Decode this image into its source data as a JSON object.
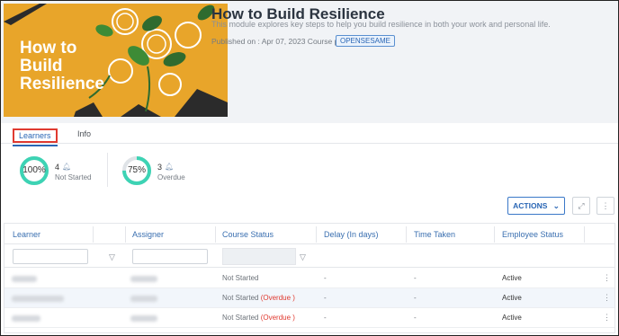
{
  "course": {
    "thumbnail_text": "How to Build Resilience",
    "title": "How to Build Resilience",
    "description": "This module explores key steps to help you build resilience in both your work and personal life.",
    "published": "Published on : Apr 07, 2023 Course provider :",
    "provider": "OPENSESAME"
  },
  "tabs": [
    {
      "label": "Learners",
      "active": true
    },
    {
      "label": "Info",
      "active": false
    }
  ],
  "stats": [
    {
      "percent": "100%",
      "count": "4",
      "label": "Not Started",
      "fraction": 1.0
    },
    {
      "percent": "75%",
      "count": "3",
      "label": "Overdue",
      "fraction": 0.75
    }
  ],
  "toolbar": {
    "actions_label": "ACTIONS"
  },
  "table": {
    "columns": [
      "Learner",
      "Assigner",
      "Course Status",
      "Delay (In days)",
      "Time Taken",
      "Employee Status"
    ],
    "rows": [
      {
        "status": "Not Started",
        "overdue": "",
        "delay": "-",
        "time": "-",
        "employee": "Active"
      },
      {
        "status": "Not Started",
        "overdue": "(Overdue )",
        "delay": "-",
        "time": "-",
        "employee": "Active"
      },
      {
        "status": "Not Started",
        "overdue": "(Overdue )",
        "delay": "-",
        "time": "-",
        "employee": "Active"
      }
    ]
  },
  "colors": {
    "accent": "#2a66b5",
    "ring": "#3dd3b4",
    "overdue": "#e03a30"
  }
}
